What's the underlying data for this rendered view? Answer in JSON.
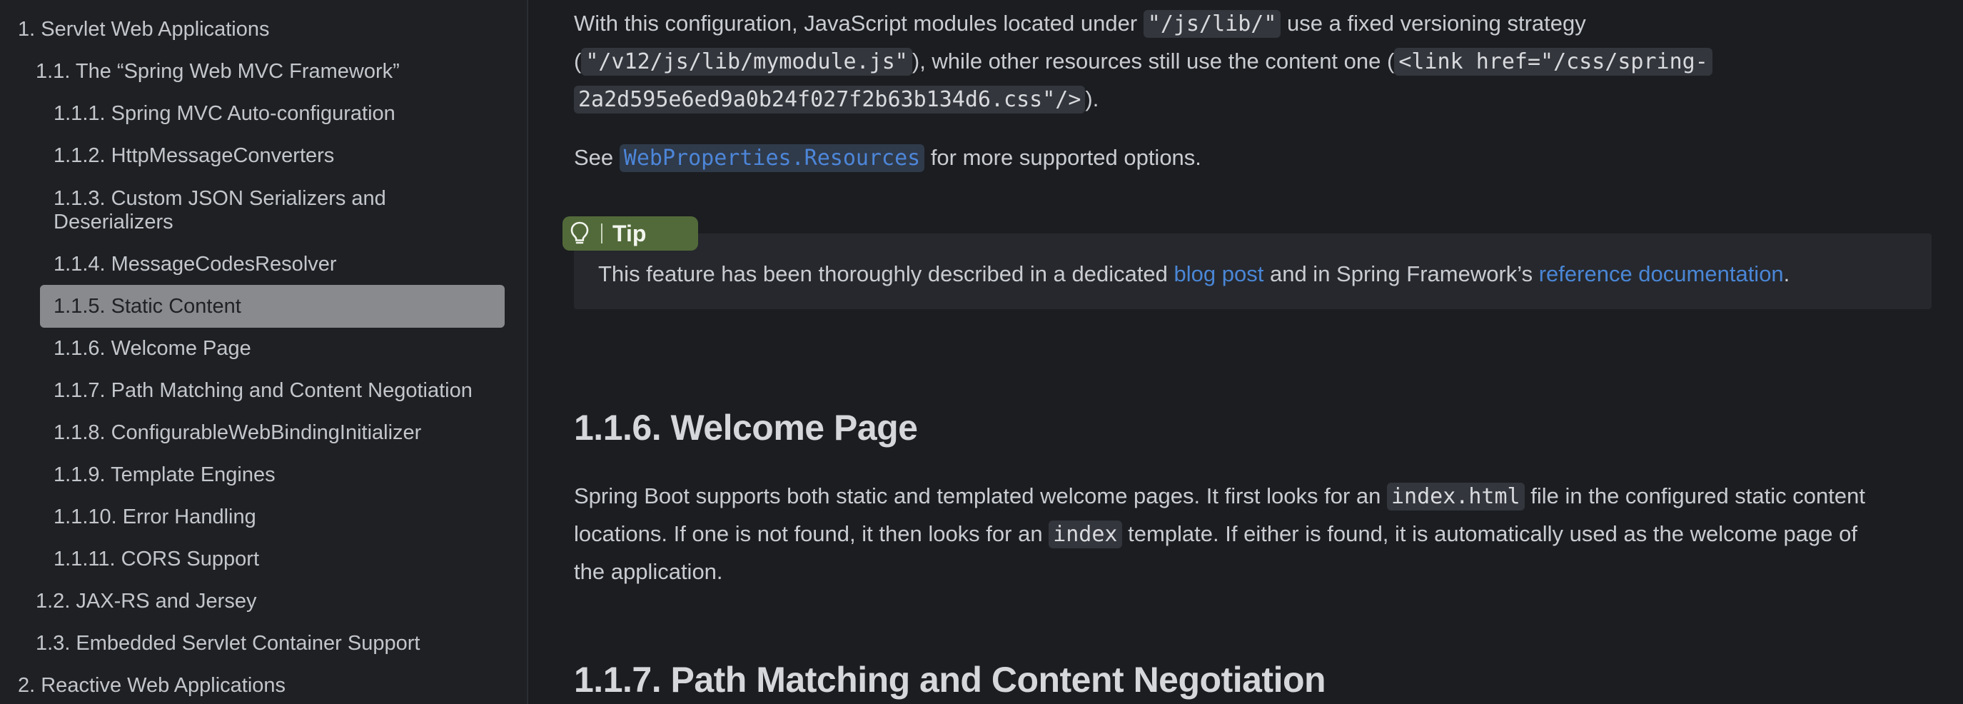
{
  "sidebar": {
    "items": [
      {
        "label": "1. Servlet Web Applications"
      },
      {
        "label": "1.1. The “Spring Web MVC Framework”"
      },
      {
        "label": "1.1.1. Spring MVC Auto-configuration"
      },
      {
        "label": "1.1.2. HttpMessageConverters"
      },
      {
        "label": "1.1.3. Custom JSON Serializers and Deserializers"
      },
      {
        "label": "1.1.4. MessageCodesResolver"
      },
      {
        "label": "1.1.5. Static Content"
      },
      {
        "label": "1.1.6. Welcome Page"
      },
      {
        "label": "1.1.7. Path Matching and Content Negotiation"
      },
      {
        "label": "1.1.8. ConfigurableWebBindingInitializer"
      },
      {
        "label": "1.1.9. Template Engines"
      },
      {
        "label": "1.1.10. Error Handling"
      },
      {
        "label": "1.1.11. CORS Support"
      },
      {
        "label": "1.2. JAX-RS and Jersey"
      },
      {
        "label": "1.3. Embedded Servlet Container Support"
      },
      {
        "label": "2. Reactive Web Applications"
      }
    ],
    "active_index": 6
  },
  "content": {
    "para1": {
      "t1": "With this configuration, JavaScript modules located under ",
      "c1": "\"/js/lib/\"",
      "t2": " use a fixed versioning strategy",
      "t3": "(",
      "c2": "\"/v12/js/lib/mymodule.js\"",
      "t4": "), while other resources still use the content one (",
      "c3a": "<link href=\"/css/spring-",
      "c3b": "2a2d595e6ed9a0b24f027f2b63b134d6.css\"/>",
      "t5": ")."
    },
    "para2": {
      "t1": "See ",
      "link": "WebProperties.Resources",
      "t2": " for more supported options."
    },
    "tip": {
      "label": "Tip",
      "t1": "This feature has been thoroughly described in a dedicated ",
      "link1": "blog post",
      "t2": " and in Spring Framework’s ",
      "link2": "reference documentation",
      "t3": "."
    },
    "heading1": "1.1.6. Welcome Page",
    "para3": {
      "t1": "Spring Boot supports both static and templated welcome pages. It first looks for an ",
      "c1": "index.html",
      "t2": " file in the configured static content",
      "t3": "locations. If one is not found, it then looks for an ",
      "c2": "index",
      "t4": " template. If either is found, it is automatically used as the welcome page of",
      "t5": "the application."
    },
    "heading2": "1.1.7. Path Matching and Content Negotiation"
  },
  "colors": {
    "background": "#1b1d21",
    "sidebar_background": "#1e2024",
    "active_item": "#888a8d",
    "link": "#4a86d6",
    "tip_badge": "#526a39",
    "tip_box": "#26282d"
  }
}
